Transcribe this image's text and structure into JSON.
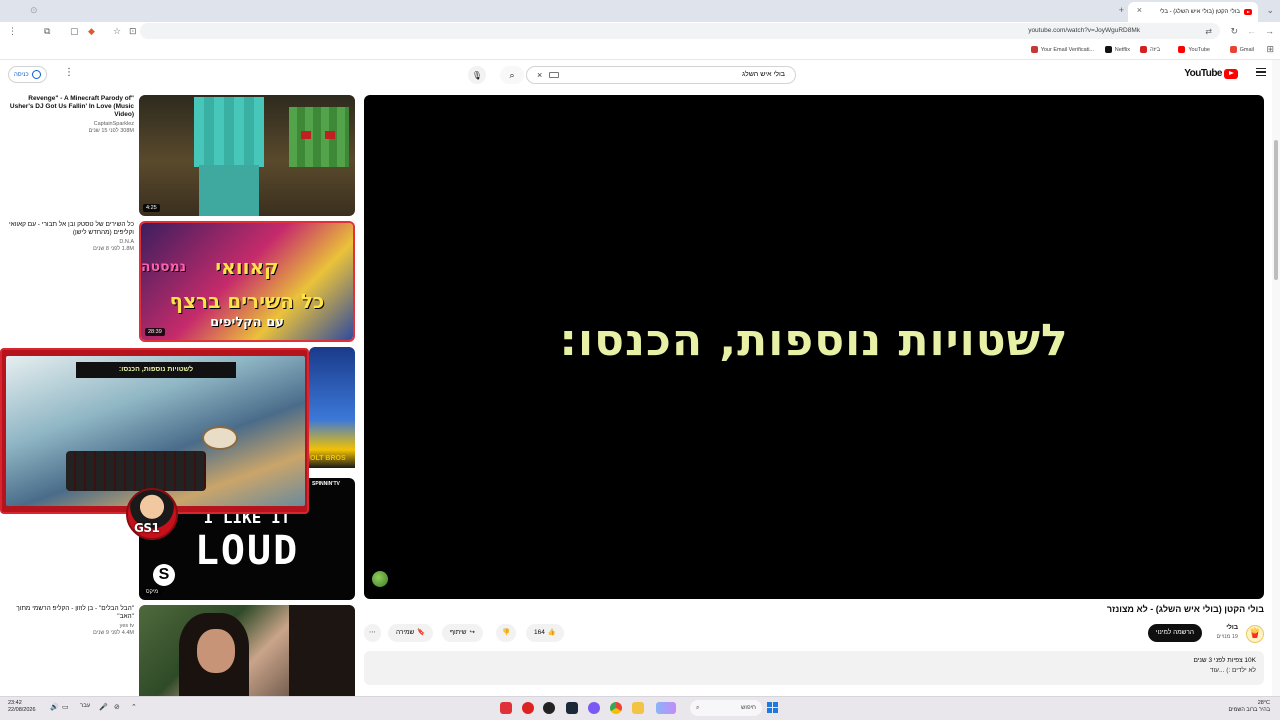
{
  "browser": {
    "tab_title": "בולי הקטן (בולי איש השלג) - בלי",
    "url": "youtube.com/watch?v=JoyWguRD8Mk",
    "bookmarks": [
      "Gmail",
      "YouTube",
      "ביזה",
      "Netflix",
      "Your Email Verificati..."
    ]
  },
  "masthead": {
    "logo_text": "YouTube",
    "search_query": "בולי איש השלג",
    "signin_label": "כניסה"
  },
  "player": {
    "caption": "לשטויות נוספות, הכנסו:"
  },
  "video": {
    "title": "בולי הקטן (בולי איש השלג) - לא מצונזר",
    "channel_name": "בולי",
    "subscribers": "19 מנויים",
    "subscribe_label": "הרשמה למינוי",
    "likes": "164",
    "share_label": "שיתוף",
    "save_label": "שמירה",
    "description_line1": "10K צפיות  לפני 3 שנים",
    "description_line2": "לא ילדים :)  ...עוד"
  },
  "recommendations": [
    {
      "title": "\"Revenge\" - A Minecraft Parody of Usher's DJ Got Us Fallin' In Love (Music Video)",
      "channel": "CaptainSparklez",
      "stats": "308M  לפני 15 שנים",
      "duration": "4:25"
    },
    {
      "title": "כל השירים של טסטק ובן אל תבורי - עם קאוואי וקליפים (מהחדש לישן)",
      "channel": "D.N.A",
      "stats": "1.8M  לפני 8 שנים",
      "duration": "28:39",
      "thumb_lines": [
        "קאוואי",
        "נמסטה",
        "כל השירים ברצף",
        "עם הקליפים"
      ]
    },
    {
      "title": "",
      "channel": "",
      "stats": "",
      "duration": "מיקס",
      "thumb_lines": [
        "I LIKE IT",
        "LOUD"
      ],
      "thumb_badges": [
        "OLT BROS",
        "SPINNIN'TV"
      ]
    },
    {
      "title": "\"הבל הבלים\" - בן לוזון - הקליפ הרשמי מתוך \"האב\"",
      "channel": "yes tv",
      "stats": "4.4M  לפני 9 שנים",
      "duration": ""
    }
  ],
  "miniplayer": {
    "caption": "לשטויות נוספות, הכנסו:",
    "badge": "GS1"
  },
  "taskbar": {
    "search_label": "חיפוש",
    "time": "23:42",
    "date": "22/08/2026",
    "weather_temp": "28°C",
    "weather_desc": "בהיר ברוב השמים",
    "language": "עבר"
  }
}
